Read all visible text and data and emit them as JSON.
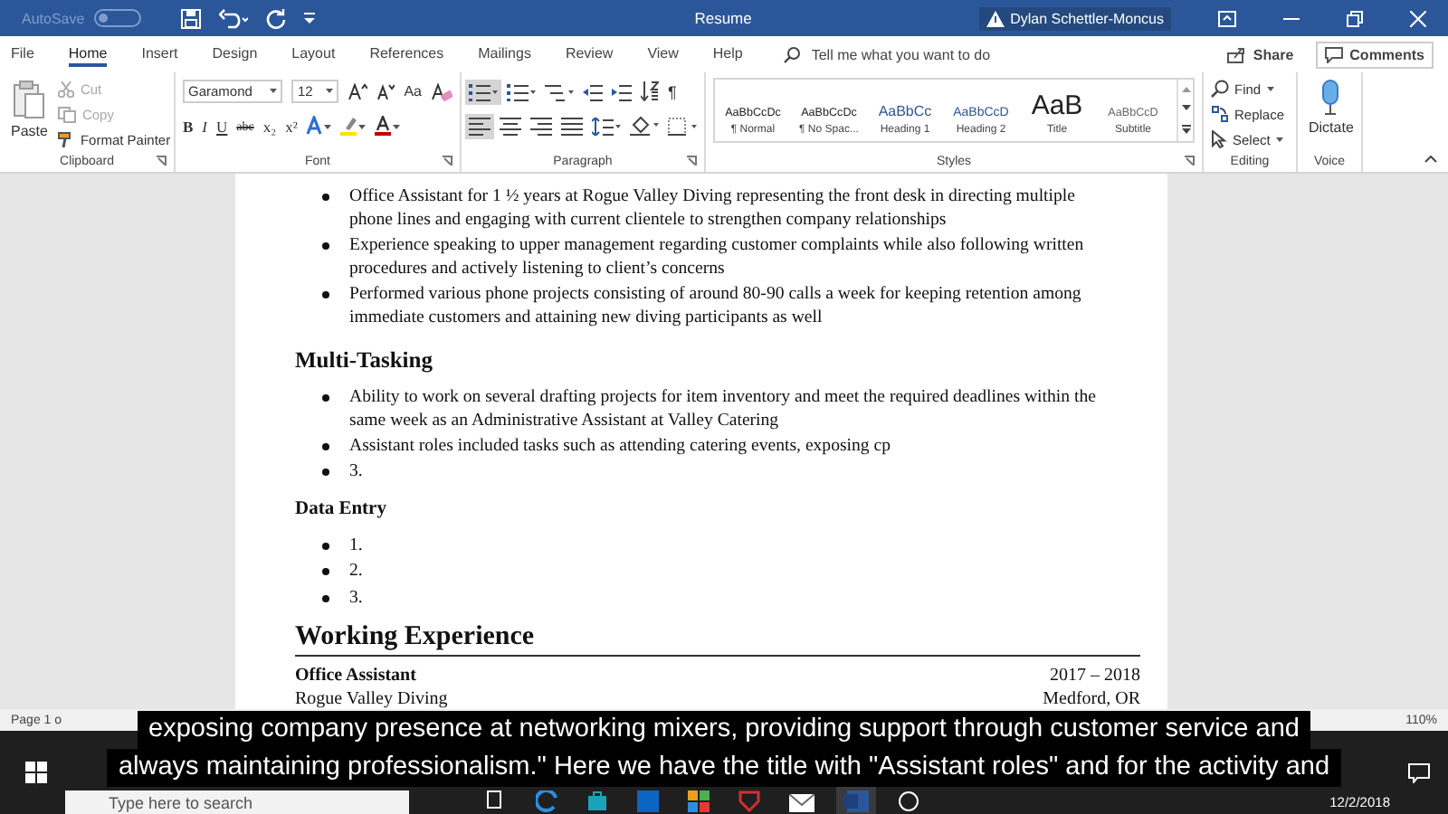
{
  "title_bar": {
    "autosave": "AutoSave",
    "autosave_on": false,
    "title": "Resume",
    "user": "Dylan Schettler-Moncus"
  },
  "tabs": [
    {
      "label": "File",
      "selected": false
    },
    {
      "label": "Home",
      "selected": true
    },
    {
      "label": "Insert",
      "selected": false
    },
    {
      "label": "Design",
      "selected": false
    },
    {
      "label": "Layout",
      "selected": false
    },
    {
      "label": "References",
      "selected": false
    },
    {
      "label": "Mailings",
      "selected": false
    },
    {
      "label": "Review",
      "selected": false
    },
    {
      "label": "View",
      "selected": false
    },
    {
      "label": "Help",
      "selected": false
    }
  ],
  "tell_me": {
    "placeholder": "Tell me what you want to do"
  },
  "share": "Share",
  "comments": "Comments",
  "clipboard": {
    "paste": "Paste",
    "cut": "Cut",
    "copy": "Copy",
    "format_painter": "Format Painter",
    "label": "Clipboard"
  },
  "font": {
    "name": "Garamond",
    "size": "12",
    "change_case": "Aa",
    "buttons": [
      "B",
      "I",
      "U",
      "abc",
      "x₂",
      "x²"
    ],
    "label": "Font"
  },
  "paragraph": {
    "pilcrow": "¶",
    "label": "Paragraph"
  },
  "styles": {
    "items": [
      {
        "preview": "AaBbCcDc",
        "name": "¶ Normal",
        "kind": "normal"
      },
      {
        "preview": "AaBbCcDc",
        "name": "¶ No Spac...",
        "kind": "normal"
      },
      {
        "preview": "AaBbCc",
        "name": "Heading 1",
        "kind": "heading1"
      },
      {
        "preview": "AaBbCcD",
        "name": "Heading 2",
        "kind": "heading2"
      },
      {
        "preview": "AaB",
        "name": "Title",
        "kind": "title"
      },
      {
        "preview": "AaBbCcD",
        "name": "Subtitle",
        "kind": "subtitle"
      }
    ],
    "label": "Styles"
  },
  "editing": {
    "find": "Find",
    "replace": "Replace",
    "select": "Select",
    "label": "Editing"
  },
  "voice": {
    "dictate": "Dictate",
    "label": "Voice"
  },
  "document": [
    {
      "kind": "bullet",
      "lines": [
        "Office Assistant for 1 ½ years at Rogue Valley Diving representing the front desk in directing multiple",
        "phone lines and engaging with current clientele to strengthen company relationships"
      ]
    },
    {
      "kind": "bullet",
      "lines": [
        "Experience speaking to upper management regarding customer complaints while also following written",
        "procedures and actively listening to client’s concerns"
      ]
    },
    {
      "kind": "bullet",
      "lines": [
        "Performed various phone projects consisting of around 80-90 calls a week for keeping retention among",
        "immediate customers and attaining new diving participants as well"
      ]
    },
    {
      "kind": "heading",
      "text": "Multi-Tasking"
    },
    {
      "kind": "bullet",
      "lines": [
        "Ability to work on several drafting projects for item inventory and meet the required deadlines within the",
        "same week as an Administrative Assistant at Valley Catering"
      ]
    },
    {
      "kind": "bullet",
      "lines": [
        "Assistant roles included tasks such as attending catering events, exposing cp"
      ]
    },
    {
      "kind": "bullet",
      "lines": [
        "3."
      ]
    },
    {
      "kind": "subheading",
      "text": "Data Entry"
    },
    {
      "kind": "bullet",
      "lines": [
        "1."
      ]
    },
    {
      "kind": "bullet",
      "lines": [
        "2."
      ]
    },
    {
      "kind": "bullet",
      "lines": [
        "3."
      ]
    },
    {
      "kind": "section",
      "text": "Working Experience"
    },
    {
      "kind": "job",
      "left": "Office Assistant",
      "right": "2017 – 2018"
    },
    {
      "kind": "job_detail",
      "left": "Rogue Valley Diving",
      "right": "Medford, OR"
    }
  ],
  "status_bar": {
    "page": "Page 1 o",
    "zoom": "110%"
  },
  "taskbar": {
    "search": {
      "placeholder": "Type here to search"
    },
    "date": "12/2/2018"
  },
  "subtitles": [
    "exposing company presence at networking mixers, providing support through customer service and",
    "always maintaining professionalism.\" Here we have the title with \"Assistant roles\" and for the activity and"
  ]
}
